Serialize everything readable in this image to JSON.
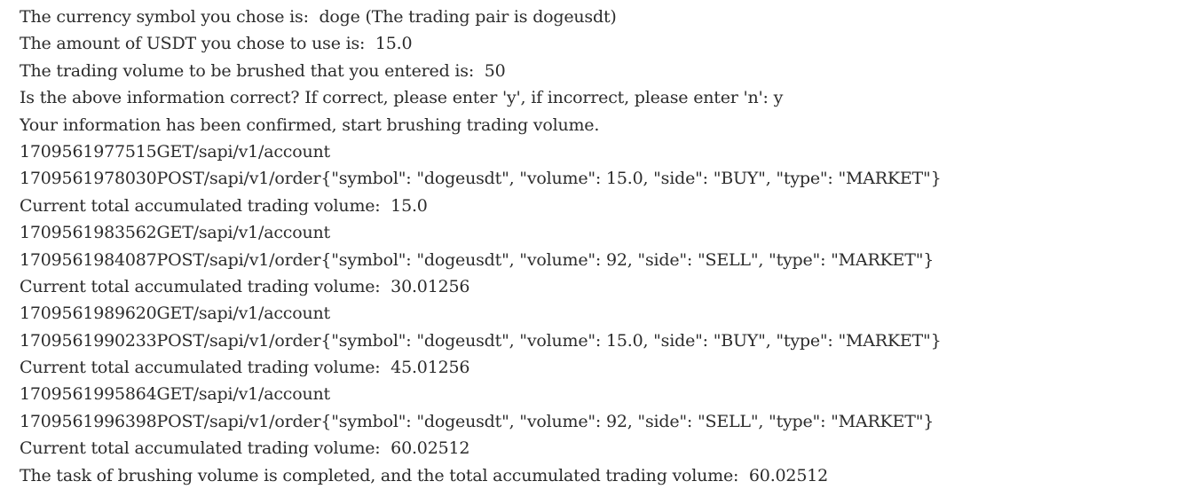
{
  "console": {
    "lines": [
      "The currency symbol you chose is:  doge (The trading pair is dogeusdt)",
      "The amount of USDT you chose to use is:  15.0",
      "The trading volume to be brushed that you entered is:  50",
      "Is the above information correct? If correct, please enter 'y', if incorrect, please enter 'n': y",
      "Your information has been confirmed, start brushing trading volume.",
      "1709561977515GET/sapi/v1/account",
      "1709561978030POST/sapi/v1/order{\"symbol\": \"dogeusdt\", \"volume\": 15.0, \"side\": \"BUY\", \"type\": \"MARKET\"}",
      "Current total accumulated trading volume:  15.0",
      "1709561983562GET/sapi/v1/account",
      "1709561984087POST/sapi/v1/order{\"symbol\": \"dogeusdt\", \"volume\": 92, \"side\": \"SELL\", \"type\": \"MARKET\"}",
      "Current total accumulated trading volume:  30.01256",
      "1709561989620GET/sapi/v1/account",
      "1709561990233POST/sapi/v1/order{\"symbol\": \"dogeusdt\", \"volume\": 15.0, \"side\": \"BUY\", \"type\": \"MARKET\"}",
      "Current total accumulated trading volume:  45.01256",
      "1709561995864GET/sapi/v1/account",
      "1709561996398POST/sapi/v1/order{\"symbol\": \"dogeusdt\", \"volume\": 92, \"side\": \"SELL\", \"type\": \"MARKET\"}",
      "Current total accumulated trading volume:  60.02512",
      "The task of brushing volume is completed, and the total accumulated trading volume:  60.02512"
    ]
  }
}
